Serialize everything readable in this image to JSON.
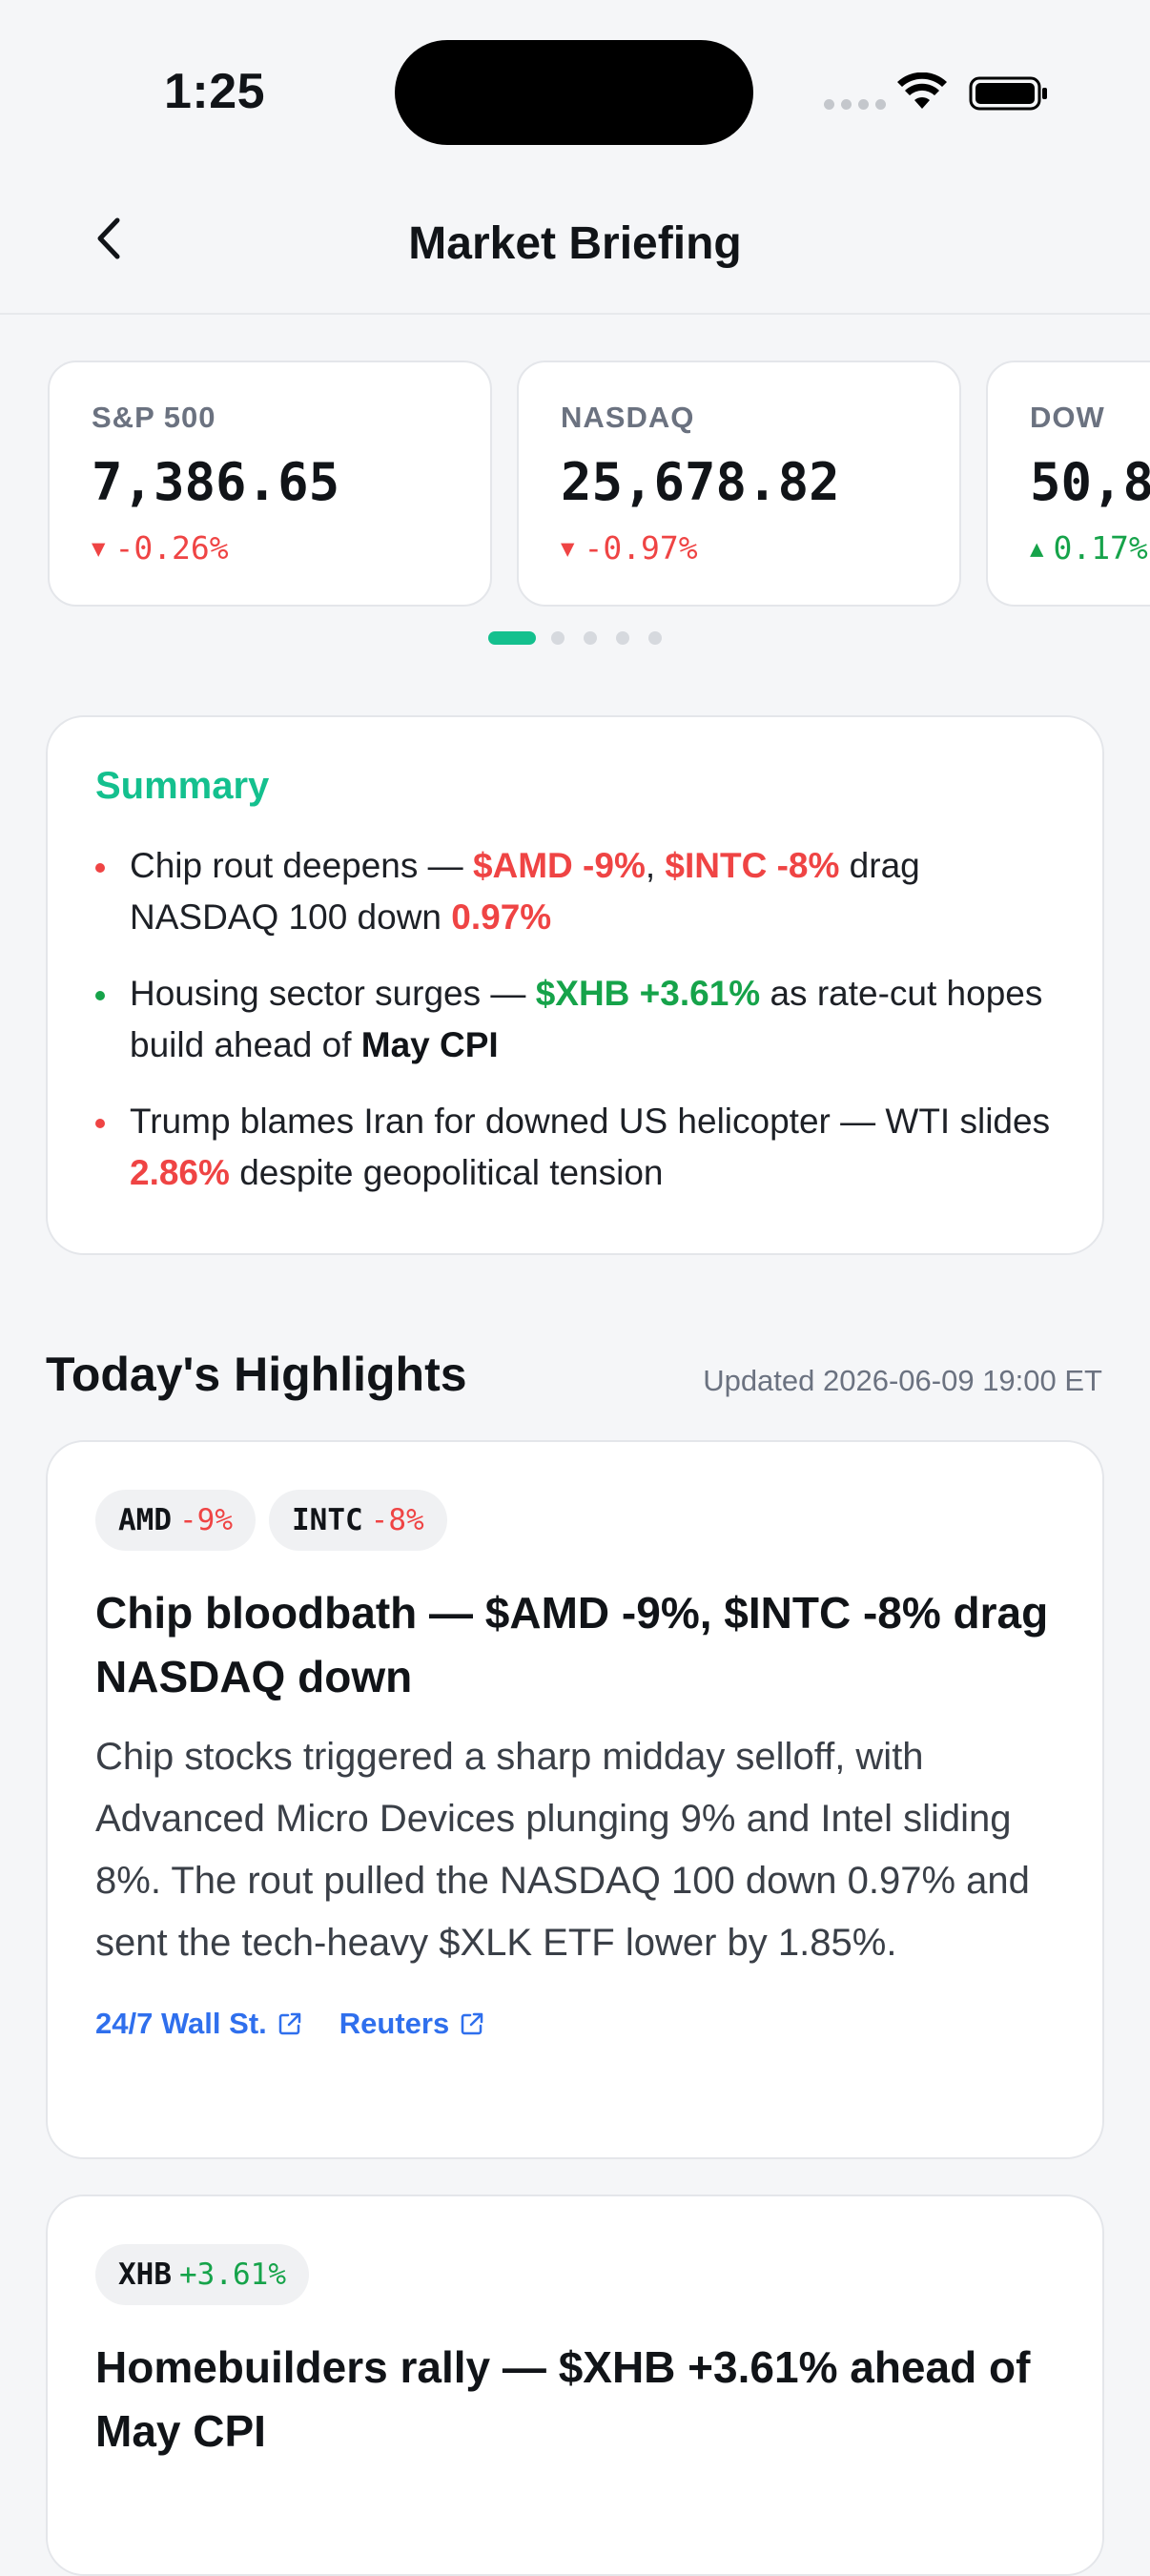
{
  "status_bar": {
    "time": "1:25"
  },
  "nav": {
    "title": "Market Briefing"
  },
  "tickers": [
    {
      "name": "S&P 500",
      "value": "7,386.65",
      "change": "-0.26%",
      "direction": "down"
    },
    {
      "name": "NASDAQ",
      "value": "25,678.82",
      "change": "-0.97%",
      "direction": "down"
    },
    {
      "name": "DOW",
      "value": "50,8",
      "change": "0.17%",
      "direction": "up"
    }
  ],
  "pager": {
    "pages": 5,
    "active": 1
  },
  "summary": {
    "title": "Summary",
    "items": [
      {
        "bullet": "red",
        "t1": "Chip rout deepens — ",
        "h1": "$AMD -9%",
        "t2": ", ",
        "h2": "$INTC -8%",
        "t3": " drag NASDAQ 100 down ",
        "h3": "0.97%"
      },
      {
        "bullet": "green",
        "t1": "Housing sector surges — ",
        "h1": "$XHB +3.61%",
        "t2": " as rate-cut hopes build ahead of ",
        "s1": "May CPI"
      },
      {
        "bullet": "red",
        "t1": "Trump blames Iran for downed US helicopter — WTI slides ",
        "h1": "2.86%",
        "t2": " despite geopolitical tension"
      }
    ]
  },
  "highlights": {
    "title": "Today's Highlights",
    "updated": "Updated 2026-06-09 19:00 ET",
    "cards": [
      {
        "tags": [
          {
            "symbol": "AMD",
            "change": "-9%",
            "direction": "down"
          },
          {
            "symbol": "INTC",
            "change": "-8%",
            "direction": "down"
          }
        ],
        "title": "Chip bloodbath — $AMD -9%, $INTC -8% drag NASDAQ down",
        "body": "Chip stocks triggered a sharp midday selloff, with Advanced Micro Devices plunging 9% and Intel sliding 8%. The rout pulled the NASDAQ 100 down 0.97% and sent the tech-heavy $XLK ETF lower by 1.85%.",
        "sources": [
          "24/7 Wall St.",
          "Reuters"
        ]
      },
      {
        "tags": [
          {
            "symbol": "XHB",
            "change": "+3.61%",
            "direction": "up"
          }
        ],
        "title": "Homebuilders rally — $XHB +3.61% ahead of May CPI"
      }
    ]
  },
  "colors": {
    "accent": "#14c08e",
    "down": "#ef4444",
    "up": "#16a34a",
    "link": "#2f6fed",
    "background": "#f5f6f8"
  }
}
